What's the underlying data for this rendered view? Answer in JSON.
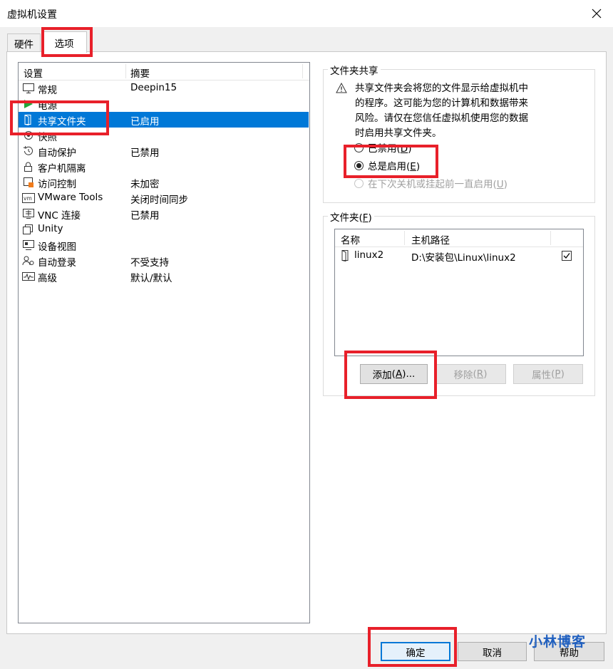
{
  "window": {
    "title": "虚拟机设置",
    "close_glyph": "✕"
  },
  "tabs": [
    {
      "label": "硬件",
      "active": false
    },
    {
      "label": "选项",
      "active": true
    }
  ],
  "settings_list": {
    "columns": [
      "设置",
      "摘要"
    ],
    "rows": [
      {
        "icon": "monitor-icon",
        "label": "常规",
        "summary": "Deepin15"
      },
      {
        "icon": "power-icon",
        "label": "电源",
        "summary": ""
      },
      {
        "icon": "shared-folder-icon",
        "label": "共享文件夹",
        "summary": "已启用",
        "selected": true
      },
      {
        "icon": "snapshot-icon",
        "label": "快照",
        "summary": ""
      },
      {
        "icon": "autoprotect-icon",
        "label": "自动保护",
        "summary": "已禁用"
      },
      {
        "icon": "lock-icon",
        "label": "客户机隔离",
        "summary": ""
      },
      {
        "icon": "access-control-icon",
        "label": "访问控制",
        "summary": "未加密"
      },
      {
        "icon": "vmware-tools-icon",
        "label": "VMware Tools",
        "summary": "关闭时间同步"
      },
      {
        "icon": "vnc-icon",
        "label": "VNC 连接",
        "summary": "已禁用"
      },
      {
        "icon": "unity-icon",
        "label": "Unity",
        "summary": ""
      },
      {
        "icon": "appliance-view-icon",
        "label": "设备视图",
        "summary": ""
      },
      {
        "icon": "autologin-icon",
        "label": "自动登录",
        "summary": "不受支持"
      },
      {
        "icon": "advanced-icon",
        "label": "高级",
        "summary": "默认/默认"
      }
    ]
  },
  "sharing": {
    "group_title": "文件夹共享",
    "warning_lines": [
      "共享文件夹会将您的文件显示给虚拟机中",
      "的程序。这可能为您的计算机和数据带来",
      "风险。请仅在您信任虚拟机使用您的数据",
      "时启用共享文件夹。"
    ],
    "options": [
      {
        "label": "已禁用",
        "key": "D",
        "checked": false,
        "disabled": false
      },
      {
        "label": "总是启用",
        "key": "E",
        "checked": true,
        "disabled": false
      },
      {
        "label": "在下次关机或挂起前一直启用",
        "key": "U",
        "checked": false,
        "disabled": true
      }
    ]
  },
  "folders": {
    "group_title": "文件夹",
    "group_key": "F",
    "columns": [
      "名称",
      "主机路径"
    ],
    "rows": [
      {
        "name": "linux2",
        "path": "D:\\安装包\\Linux\\linux2",
        "enabled": true
      }
    ],
    "buttons": {
      "add": {
        "label": "添加",
        "key": "A",
        "suffix": "..."
      },
      "remove": {
        "label": "移除",
        "key": "R"
      },
      "properties": {
        "label": "属性",
        "key": "P"
      }
    }
  },
  "footer": {
    "ok": "确定",
    "cancel": "取消",
    "help": "帮助",
    "watermark": "小林博客"
  },
  "colors": {
    "accent": "#0078d7",
    "highlight": "#e8202a",
    "power_green": "#22a73a",
    "watermark": "#1f5fbf"
  }
}
